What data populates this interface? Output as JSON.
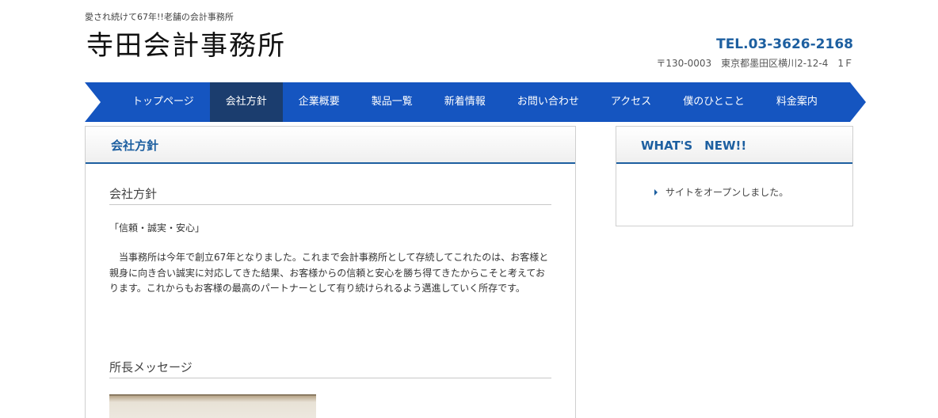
{
  "header": {
    "tagline": "愛され続けて67年!!老舗の会計事務所",
    "site_title": "寺田会計事務所",
    "tel": "TEL.03-3626-2168",
    "address": "〒130-0003　東京都墨田区横川2-12-4　1Ｆ"
  },
  "nav": {
    "items": [
      {
        "label": "トップページ"
      },
      {
        "label": "会社方針"
      },
      {
        "label": "企業概要"
      },
      {
        "label": "製品一覧"
      },
      {
        "label": "新着情報"
      },
      {
        "label": "お問い合わせ"
      },
      {
        "label": "アクセス"
      },
      {
        "label": "僕のひとこと"
      },
      {
        "label": "料金案内"
      }
    ],
    "active": "会社方針",
    "color": "#1555c0",
    "active_color": "#1b3d6e"
  },
  "main": {
    "panel_title": "会社方針",
    "section1_heading": "会社方針",
    "quote": "「信頼・誠実・安心」",
    "paragraph": "当事務所は今年で創立67年となりました。これまで会計事務所として存続してこれたのは、お客様と親身に向き合い誠実に対応してきた結果、お客様からの信頼と安心を勝ち得てきたからこそと考えております。これからもお客様の最高のパートナーとして有り続けられるよう邁進していく所存です。",
    "section2_heading": "所長メッセージ"
  },
  "sidebar": {
    "title": "WHAT'S　NEW!!",
    "news": [
      {
        "text": "サイトをオープンしました。"
      }
    ]
  },
  "colors": {
    "accent": "#1d5fa0"
  }
}
